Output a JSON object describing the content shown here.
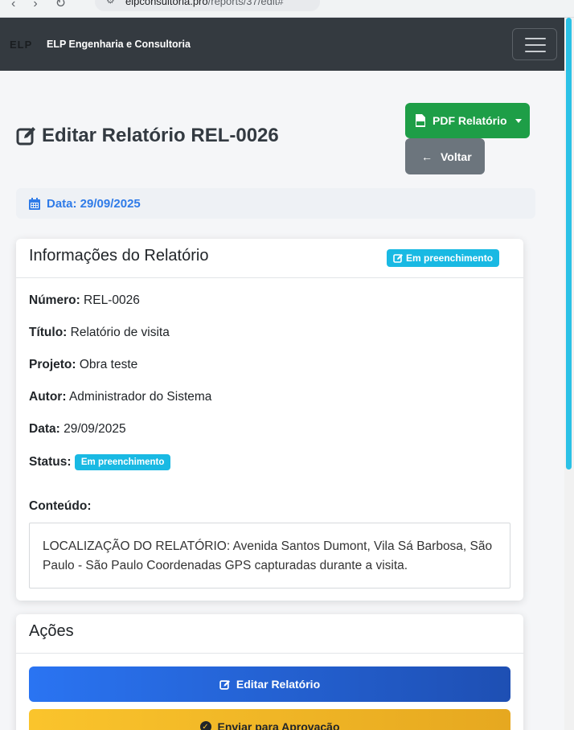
{
  "browser": {
    "url_domain": "elpconsultoria.pro",
    "url_path": "/reports/37/edit#"
  },
  "navbar": {
    "logo_text": "ELP",
    "brand": "ELP Engenharia e Consultoria"
  },
  "page": {
    "title": "Editar Relatório REL-0026",
    "pdf_button": "PDF Relatório",
    "back_button": "Voltar",
    "date_label": "Data: 29/09/2025"
  },
  "info_card": {
    "title": "Informações do Relatório",
    "status_badge": "Em preenchimento",
    "fields": [
      {
        "label": "Número:",
        "value": "REL-0026"
      },
      {
        "label": "Título:",
        "value": "Relatório de visita"
      },
      {
        "label": "Projeto:",
        "value": "Obra teste"
      },
      {
        "label": "Autor:",
        "value": "Administrador do Sistema"
      },
      {
        "label": "Data:",
        "value": "29/09/2025"
      }
    ],
    "status_label": "Status:",
    "status_value": "Em preenchimento",
    "content_label": "Conteúdo:",
    "content_text": "LOCALIZAÇÃO DO RELATÓRIO: Avenida Santos Dumont, Vila Sá Barbosa, São Paulo - São Paulo Coordenadas GPS capturadas durante a visita."
  },
  "actions_card": {
    "title": "Ações",
    "edit_button": "Editar Relatório",
    "send_button": "Enviar para Aprovação"
  },
  "colors": {
    "navbar": "#343a40",
    "success": "#1e9e47",
    "secondary": "#6c757d",
    "info": "#19b9e3",
    "primary": "#2a74f2",
    "warning": "#fac42c"
  }
}
